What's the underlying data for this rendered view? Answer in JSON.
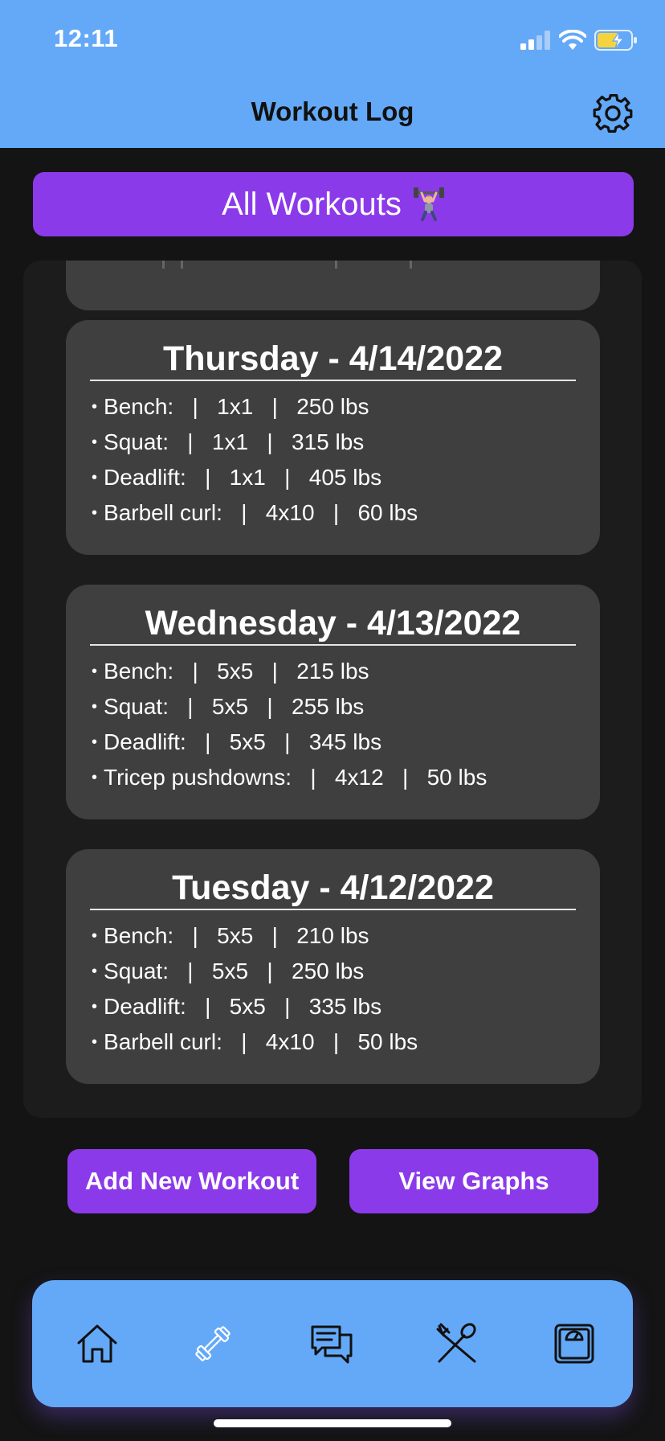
{
  "status_bar": {
    "time": "12:11"
  },
  "header": {
    "title": "Workout Log"
  },
  "banner": {
    "label": "All Workouts"
  },
  "workouts": [
    {
      "date": "Thursday - 4/14/2022",
      "exercises": [
        "Bench:   |   1x1   |   250 lbs",
        "Squat:   |   1x1   |   315 lbs",
        "Deadlift:   |   1x1   |   405 lbs",
        "Barbell curl:   |   4x10   |   60 lbs"
      ]
    },
    {
      "date": "Wednesday - 4/13/2022",
      "exercises": [
        "Bench:   |   5x5   |   215 lbs",
        "Squat:   |   5x5   |   255 lbs",
        "Deadlift:   |   5x5   |   345 lbs",
        "Tricep pushdowns:   |   4x12   |   50 lbs"
      ]
    },
    {
      "date": "Tuesday - 4/12/2022",
      "exercises": [
        "Bench:   |   5x5   |   210 lbs",
        "Squat:   |   5x5   |   250 lbs",
        "Deadlift:   |   5x5   |   335 lbs",
        "Barbell curl:   |   4x10   |   50 lbs"
      ]
    }
  ],
  "actions": {
    "add_label": "Add New Workout",
    "graphs_label": "View Graphs"
  },
  "bottom_nav": {
    "items": [
      {
        "icon": "home-icon"
      },
      {
        "icon": "dumbbell-icon"
      },
      {
        "icon": "chat-icon"
      },
      {
        "icon": "fork-spoon-icon"
      },
      {
        "icon": "scale-icon"
      }
    ]
  },
  "colors": {
    "header_bg": "#64a9f7",
    "accent_purple": "#8b3aea",
    "card_bg": "#3f3f3f",
    "page_bg": "#141414"
  }
}
